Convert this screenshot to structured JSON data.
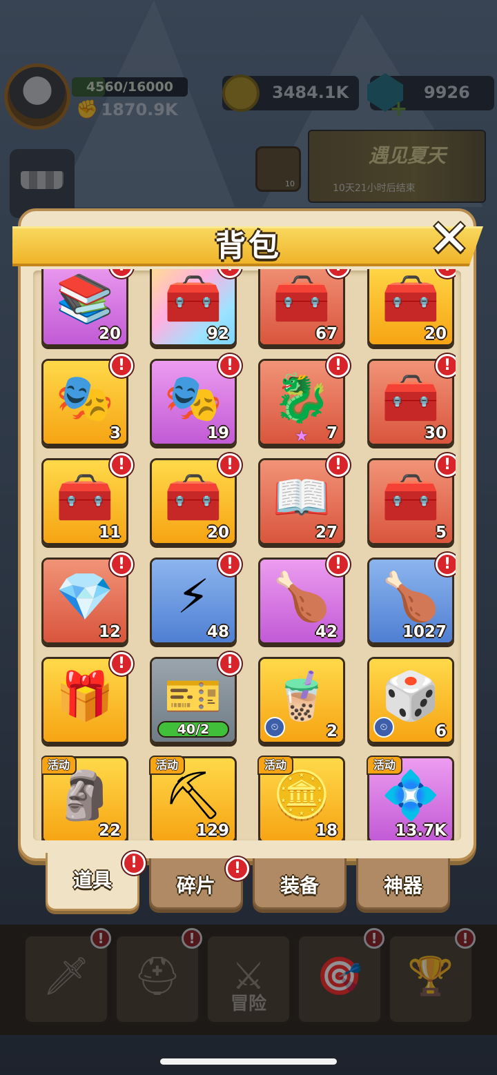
{
  "hud": {
    "xp": "4560/16000",
    "xp_fraction": 0.285,
    "power": "1870.9K",
    "coins": "3484.1K",
    "gems": "9926",
    "scroll_badge": "10",
    "event": {
      "title": "遇见夏天",
      "subtitle": "10天21小时后结束"
    }
  },
  "panel": {
    "title": "背包"
  },
  "items": [
    {
      "icon": "purple-book-chest-icon",
      "glyph": "📚",
      "quality": "purple",
      "qty": "20",
      "alert": true
    },
    {
      "icon": "rainbow-chest-icon",
      "glyph": "🧰",
      "quality": "rainbow",
      "qty": "92",
      "alert": true
    },
    {
      "icon": "red-gold-chest-icon",
      "glyph": "🧰",
      "quality": "red",
      "qty": "67",
      "alert": true
    },
    {
      "icon": "silver-chest-icon",
      "glyph": "🧰",
      "quality": "gold",
      "qty": "20",
      "alert": true
    },
    {
      "icon": "gold-hero-chest-icon",
      "glyph": "🎭",
      "quality": "gold",
      "qty": "3",
      "alert": true
    },
    {
      "icon": "purple-hero-chest-icon",
      "glyph": "🎭",
      "quality": "purple",
      "qty": "19",
      "alert": true
    },
    {
      "icon": "dragon-chest-icon",
      "glyph": "🐉",
      "quality": "red",
      "qty": "7",
      "alert": true,
      "star": true
    },
    {
      "icon": "red-chest-icon",
      "glyph": "🧰",
      "quality": "red",
      "qty": "30",
      "alert": true
    },
    {
      "icon": "gold-winged-chest-icon",
      "glyph": "🧰",
      "quality": "gold",
      "qty": "11",
      "alert": true
    },
    {
      "icon": "gold-winged-chest-icon",
      "glyph": "🧰",
      "quality": "gold",
      "qty": "20",
      "alert": true
    },
    {
      "icon": "tome-chest-icon",
      "glyph": "📖",
      "quality": "red",
      "qty": "27",
      "alert": true
    },
    {
      "icon": "red-chest-icon",
      "glyph": "🧰",
      "quality": "red",
      "qty": "5",
      "alert": true
    },
    {
      "icon": "crystal-chest-icon",
      "glyph": "💎",
      "quality": "red",
      "qty": "12",
      "alert": true
    },
    {
      "icon": "lightning-energy-icon",
      "glyph": "⚡",
      "quality": "blue",
      "qty": "48",
      "alert": true
    },
    {
      "icon": "meat-leg-icon",
      "glyph": "🍗",
      "quality": "purple",
      "qty": "42",
      "alert": true
    },
    {
      "icon": "meat-leg-icon",
      "glyph": "🍗",
      "quality": "blue",
      "qty": "1027",
      "alert": true
    },
    {
      "icon": "treasure-pile-icon",
      "glyph": "🎁",
      "quality": "gold",
      "qty": "",
      "alert": true
    },
    {
      "icon": "card-fragment-icon",
      "glyph": "🎫",
      "quality": "gray",
      "qty": "",
      "progress": "40/2",
      "alert": true
    },
    {
      "icon": "milk-tea-icon",
      "glyph": "🧋",
      "quality": "gold",
      "qty": "2",
      "alert": false,
      "clock": true
    },
    {
      "icon": "dice-icon",
      "glyph": "🎲",
      "quality": "gold",
      "qty": "6",
      "alert": false,
      "clock": true
    },
    {
      "icon": "totem-tablet-icon",
      "glyph": "🗿",
      "quality": "gold",
      "qty": "22",
      "alert": false,
      "tag": "活动"
    },
    {
      "icon": "pickaxe-icon",
      "glyph": "⛏",
      "quality": "gold",
      "qty": "129",
      "alert": false,
      "tag": "活动"
    },
    {
      "icon": "gold-coin-icon",
      "glyph": "🪙",
      "quality": "gold",
      "qty": "18",
      "alert": false,
      "tag": "活动"
    },
    {
      "icon": "blue-crystal-icon",
      "glyph": "💠",
      "quality": "purple",
      "qty": "13.7K",
      "alert": false,
      "tag": "活动"
    }
  ],
  "tabs": [
    {
      "label": "道具",
      "active": true,
      "alert": true
    },
    {
      "label": "碎片",
      "active": false,
      "alert": true
    },
    {
      "label": "装备",
      "active": false,
      "alert": false
    },
    {
      "label": "神器",
      "active": false,
      "alert": false
    }
  ],
  "nav": [
    {
      "name": "nav-banner",
      "glyph": "🗡",
      "label": "",
      "alert": true
    },
    {
      "name": "nav-helmet",
      "glyph": "⛑",
      "label": "",
      "alert": true
    },
    {
      "name": "nav-adventure",
      "glyph": "⚔",
      "label": "冒险",
      "alert": false
    },
    {
      "name": "nav-target",
      "glyph": "🎯",
      "label": "",
      "alert": true
    },
    {
      "name": "nav-trophy",
      "glyph": "🏆",
      "label": "",
      "alert": true
    }
  ],
  "alert_mark": "!"
}
